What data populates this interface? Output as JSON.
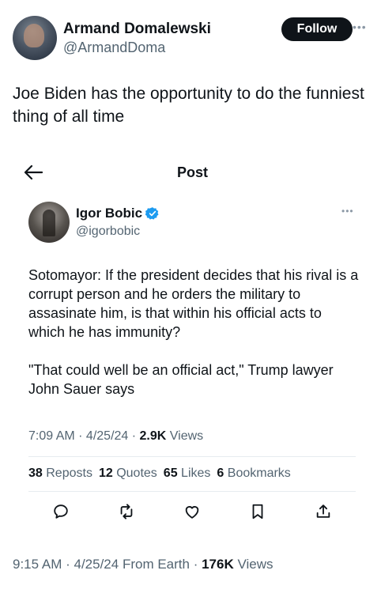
{
  "author": {
    "name": "Armand Domalewski",
    "handle": "@ArmandDoma",
    "follow_label": "Follow",
    "more_icon": "more-horizontal-icon"
  },
  "tweet": {
    "text": "Joe Biden has the opportunity to do the funniest thing of all time"
  },
  "quoted_post": {
    "header_title": "Post",
    "back_icon": "arrow-left-icon",
    "author_name": "Igor Bobic",
    "author_handle": "@igorbobic",
    "verified_icon": "verified-badge-icon",
    "paragraphs": [
      "Sotomayor: If the president decides that his rival is a corrupt person and he orders the military to assasinate him, is that within his official acts to which he has immunity?",
      "\"That could well be an official act,\" Trump lawyer John Sauer says"
    ],
    "time": "7:09 AM",
    "date": "4/25/24",
    "views_count": "2.9K",
    "views_label": "Views",
    "stats": {
      "reposts_count": "38",
      "reposts_label": "Reposts",
      "quotes_count": "12",
      "quotes_label": "Quotes",
      "likes_count": "65",
      "likes_label": "Likes",
      "bookmarks_count": "6",
      "bookmarks_label": "Bookmarks"
    },
    "actions": [
      "reply-icon",
      "repost-icon",
      "like-icon",
      "bookmark-icon",
      "share-icon"
    ]
  },
  "footer": {
    "time": "9:15 AM",
    "date": "4/25/24",
    "source": "From Earth",
    "views_count": "176K",
    "views_label": "Views"
  },
  "colors": {
    "text": "#0f1419",
    "secondary": "#536471",
    "verified": "#1d9bf0",
    "divider": "#e6ecf0"
  }
}
